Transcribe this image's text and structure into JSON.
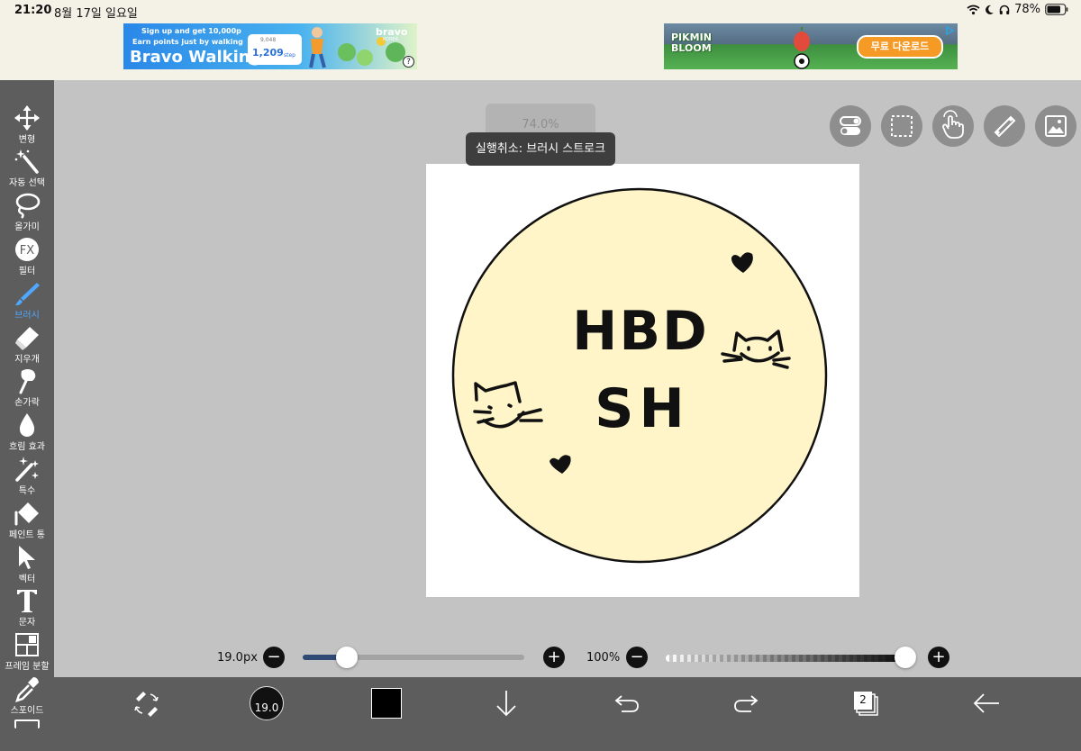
{
  "status": {
    "time": "21:20",
    "date": "8월 17일 일요일",
    "battery": "78%"
  },
  "ads": {
    "bravo": {
      "headline": "Sign up and get 10,000p",
      "sub": "Earn points just by walking",
      "title": "Bravo Walking",
      "steps": "1,209",
      "steps_unit": "step",
      "steps_small": "9,048",
      "brand": "bravo",
      "brand_sub": "KOREA"
    },
    "pikmin": {
      "brand": "PIKMIN BLOOM",
      "cta": "무료 다운로드"
    }
  },
  "tools": [
    {
      "label": "변형",
      "icon": "move-icon"
    },
    {
      "label": "자동 선택",
      "icon": "magic-wand-icon"
    },
    {
      "label": "올가미",
      "icon": "lasso-icon"
    },
    {
      "label": "필터",
      "icon": "fx-icon"
    },
    {
      "label": "브러시",
      "icon": "brush-icon",
      "active": true
    },
    {
      "label": "지우개",
      "icon": "eraser-icon"
    },
    {
      "label": "손가락",
      "icon": "finger-icon"
    },
    {
      "label": "흐림 효과",
      "icon": "blur-drop-icon"
    },
    {
      "label": "특수",
      "icon": "special-icon"
    },
    {
      "label": "페인트 통",
      "icon": "paint-bucket-icon"
    },
    {
      "label": "벡터",
      "icon": "vector-icon"
    },
    {
      "label": "문자",
      "icon": "text-icon"
    },
    {
      "label": "프레임 분할",
      "icon": "frame-divide-icon"
    },
    {
      "label": "스포이드",
      "icon": "eyedropper-icon"
    }
  ],
  "canvas": {
    "zoom": "74.0%",
    "toast": "실행취소: 브러시 스트로크",
    "drawing_text": [
      "HBD",
      "SH"
    ],
    "circle_fill": "#fff5c9",
    "stroke_color": "#111111"
  },
  "brush": {
    "size": "19.0px",
    "size_badge": "19.0",
    "opacity": "100%",
    "size_fraction": 0.2,
    "opacity_fraction": 1.0,
    "color": "#000000"
  },
  "layers": {
    "count": "2"
  },
  "colors": {
    "accent": "#4fa7ff",
    "sidebar": "#5d5d5d",
    "canvas_bg": "#c3c3c3",
    "slider_fill": "#2f4b75"
  }
}
